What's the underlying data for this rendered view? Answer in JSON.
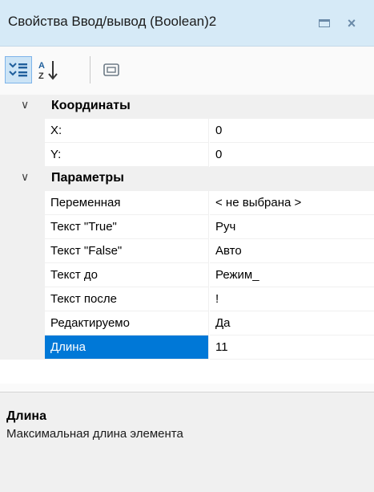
{
  "window": {
    "title": "Свойства Ввод/вывод (Boolean)2"
  },
  "toolbar": {
    "buttons": [
      {
        "name": "categorized-view-icon",
        "active": true
      },
      {
        "name": "alphabetical-sort-icon",
        "active": false
      },
      {
        "name": "property-pages-icon",
        "active": false
      }
    ]
  },
  "grid": {
    "categories": [
      {
        "label": "Координаты",
        "expanded": true,
        "properties": [
          {
            "name": "X:",
            "value": "0"
          },
          {
            "name": "Y:",
            "value": "0"
          }
        ]
      },
      {
        "label": "Параметры",
        "expanded": true,
        "properties": [
          {
            "name": "Переменная",
            "value": "< не выбрана >"
          },
          {
            "name": "Текст \"True\"",
            "value": "Руч"
          },
          {
            "name": "Текст \"False\"",
            "value": "Авто"
          },
          {
            "name": "Текст до",
            "value": "Режим_"
          },
          {
            "name": "Текст после",
            "value": "!"
          },
          {
            "name": "Редактируемо",
            "value": "Да"
          },
          {
            "name": "Длина",
            "value": "11"
          }
        ]
      }
    ],
    "selected_property": "Длина"
  },
  "description": {
    "title": "Длина",
    "text": "Максимальная длина элемента"
  },
  "colors": {
    "titlebar": "#d6eaf7",
    "selection": "#0078d7",
    "category_background": "#f0f0f0"
  }
}
